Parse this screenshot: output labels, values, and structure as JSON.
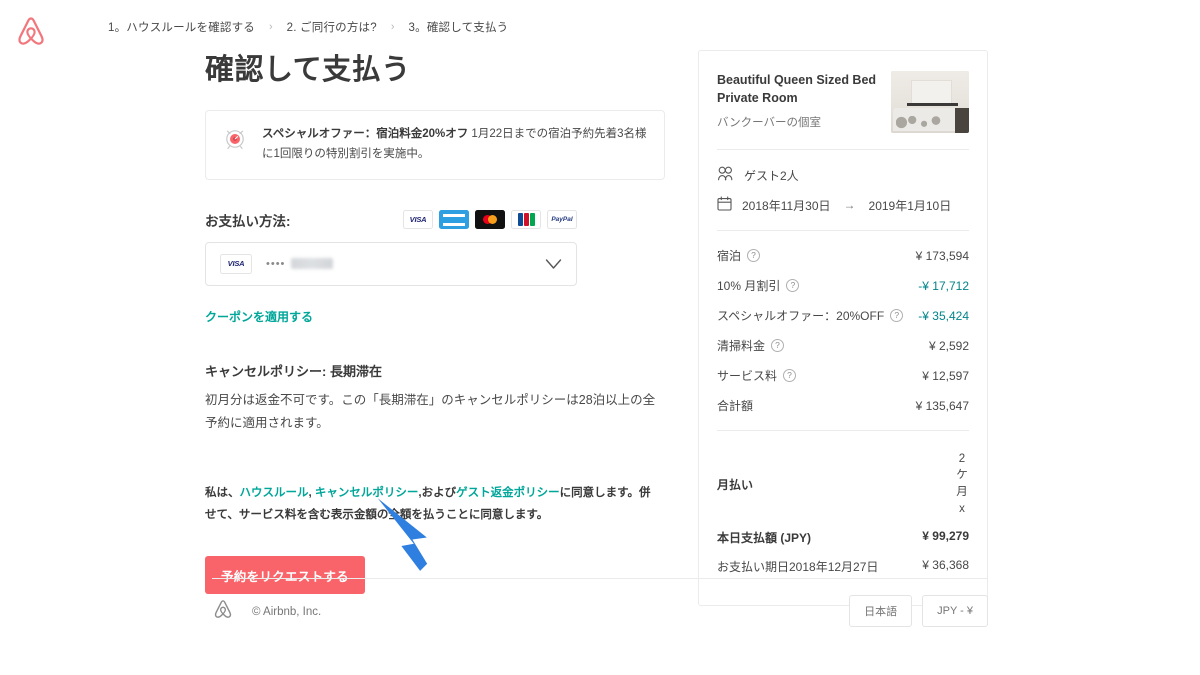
{
  "header": {
    "logo_name": "airbnb-logo",
    "breadcrumb": [
      {
        "label": "1。ハウスルールを確認する"
      },
      {
        "label": "2. ご同行の方は?"
      },
      {
        "label": "3。確認して支払う"
      }
    ],
    "separator": "›"
  },
  "main": {
    "title": "確認して支払う",
    "offer": {
      "icon": "alarm-clock-icon",
      "headline": "スペシャルオファー：宿泊料金20%オフ",
      "body": "1月22日までの宿泊予約先着3名様に1回限りの特別割引を実施中。"
    },
    "payment": {
      "label": "お支払い方法:",
      "accepted": [
        {
          "name": "visa-logo",
          "text": "VISA"
        },
        {
          "name": "amex-logo",
          "text": "AMEX"
        },
        {
          "name": "mastercard-logo",
          "text": "Mastercard"
        },
        {
          "name": "jcb-logo",
          "text": "JCB"
        },
        {
          "name": "paypal-logo",
          "text": "PayPal"
        }
      ],
      "selected_card": {
        "brand": "VISA",
        "mask_dots": "••••",
        "number_redacted": true
      },
      "dropdown_icon": "chevron-down-icon"
    },
    "coupon_link": "クーポンを適用する",
    "cancellation": {
      "title": "キャンセルポリシー: 長期滞在",
      "body": "初月分は返金不可です。この「長期滞在」のキャンセルポリシーは28泊以上の全予約に適用されます。"
    },
    "agreement": {
      "part1": "私は、",
      "link1": "ハウスルール",
      "part2": ", ",
      "link2": "キャンセルポリシー",
      "part3": ",および",
      "link3": "ゲスト返金ポリシー",
      "part4": "に同意します。併せて、サービス料を含む表示金額の全額を払うことに同意します。"
    },
    "cta_label": "予約をリクエストする"
  },
  "summary": {
    "listing_title": "Beautiful Queen Sized Bed Private Room",
    "listing_subtitle": "バンクーバーの個室",
    "thumbnail_name": "listing-thumbnail",
    "guests": {
      "icon": "guests-icon",
      "label": "ゲスト2人"
    },
    "dates": {
      "icon": "calendar-icon",
      "checkin": "2018年11月30日",
      "arrow": "→",
      "checkout": "2019年1月10日"
    },
    "price_rows": [
      {
        "label": "宿泊",
        "info": "?",
        "value": "¥ 173,594",
        "green": false
      },
      {
        "label": "10% 月割引",
        "info": "?",
        "value": "-¥ 17,712",
        "green": true
      },
      {
        "label": "スペシャルオファー：20%OFF",
        "info": "?",
        "value": "-¥ 35,424",
        "green": true
      },
      {
        "label": "清掃料金",
        "info": "?",
        "value": "¥ 2,592",
        "green": false
      },
      {
        "label": "サービス料",
        "info": "?",
        "value": "¥ 12,597",
        "green": false
      },
      {
        "label": "合計額",
        "info": "",
        "value": "¥ 135,647",
        "green": false
      }
    ],
    "monthly": {
      "label": "月払い",
      "count_chars": "2ケ月x"
    },
    "totals": [
      {
        "label": "本日支払額 (JPY)",
        "value": "¥ 99,279",
        "bold": true
      },
      {
        "label": "お支払い期日2018年12月27日",
        "value": "¥ 36,368",
        "bold": false
      }
    ]
  },
  "footer": {
    "logo_name": "airbnb-footer-logo",
    "copyright": "© Airbnb, Inc.",
    "language_button": "日本語",
    "currency_button": "JPY - ¥"
  },
  "annotation": {
    "arrow_name": "pointer-arrow",
    "color": "#2e7fe0"
  },
  "colors": {
    "brand_pink": "#ff5a5f",
    "cta_red": "#f8646a",
    "teal": "#00a699",
    "green": "#008489",
    "text": "#484848"
  }
}
